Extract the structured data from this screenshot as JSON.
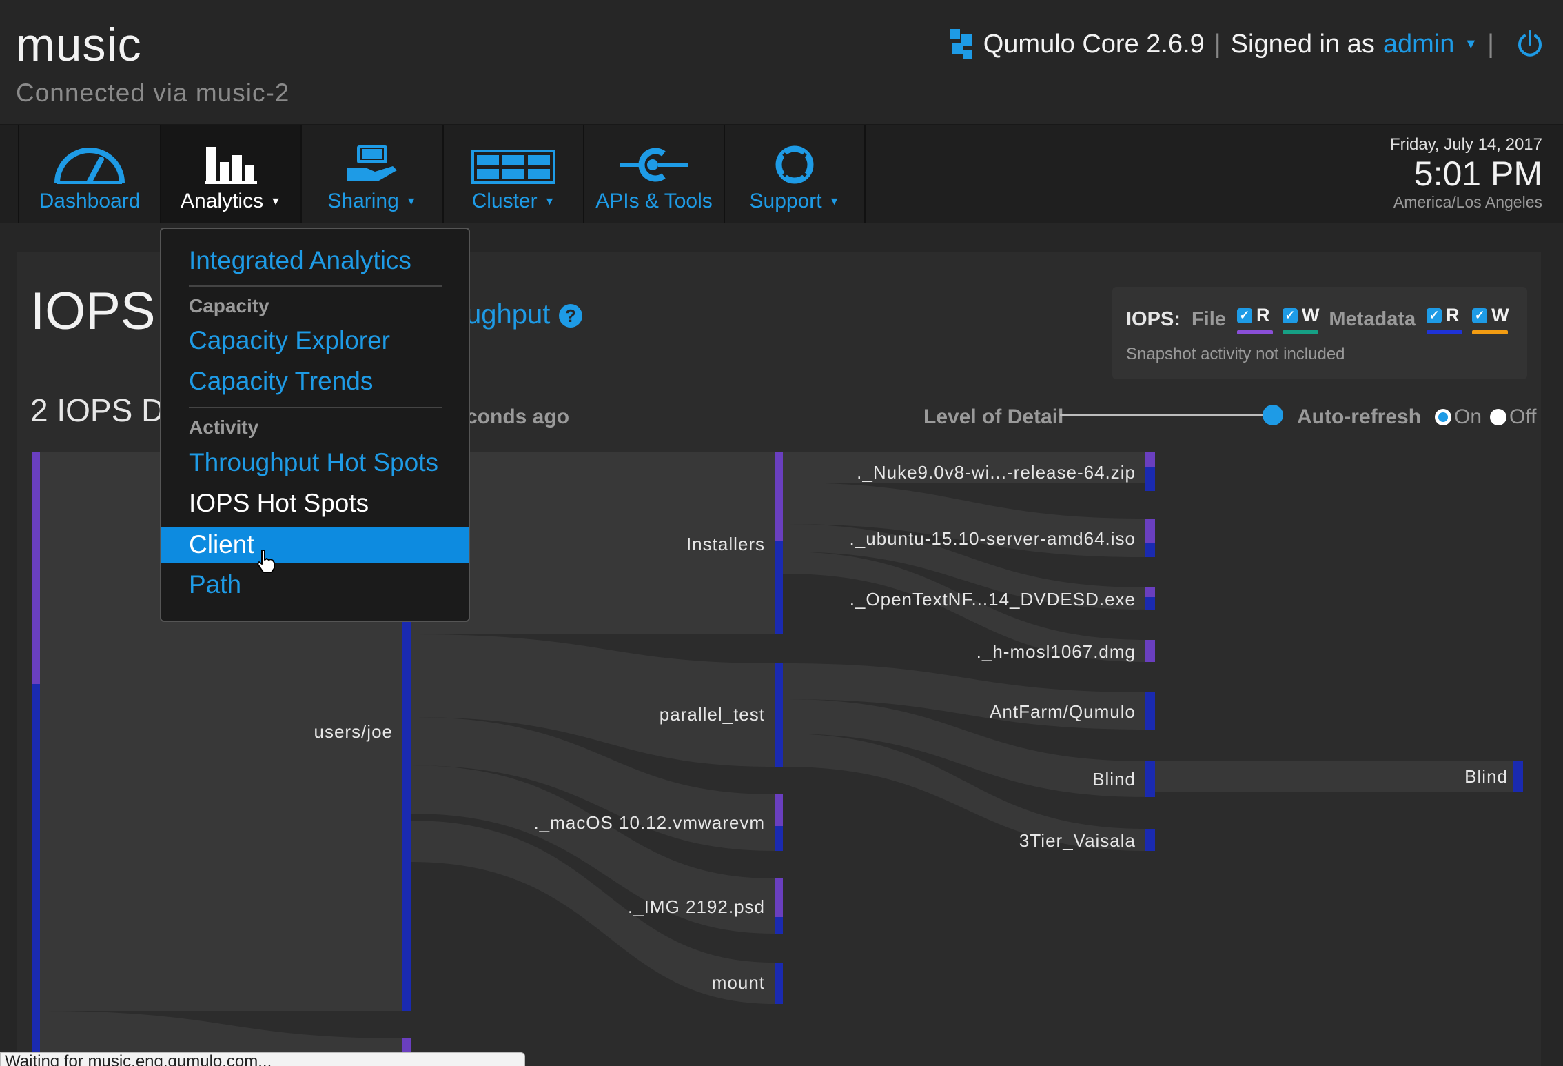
{
  "header": {
    "cluster_name": "music",
    "connected_via": "Connected via music-2",
    "product": "Qumulo Core 2.6.9",
    "signed_in_as": "Signed in as",
    "username": "admin"
  },
  "nav": {
    "items": [
      {
        "label": "Dashboard",
        "icon": "gauge-icon"
      },
      {
        "label": "Analytics",
        "icon": "bar-chart-icon",
        "active": true
      },
      {
        "label": "Sharing",
        "icon": "hand-share-icon"
      },
      {
        "label": "Cluster",
        "icon": "server-rack-icon"
      },
      {
        "label": "APIs & Tools",
        "icon": "api-plug-icon"
      },
      {
        "label": "Support",
        "icon": "lifebuoy-icon"
      }
    ]
  },
  "datetime": {
    "date": "Friday, July 14, 2017",
    "time": "5:01 PM",
    "timezone": "America/Los Angeles"
  },
  "page": {
    "title": "IOPS I",
    "title_link": "ughput",
    "summary": "2 IOPS D",
    "seconds_ago": "conds ago"
  },
  "legend": {
    "iops_label": "IOPS:",
    "file_label": "File",
    "metadata_label": "Metadata",
    "r": "R",
    "w": "W",
    "note": "Snapshot activity not included",
    "colors": {
      "file_r": "#8a4fd8",
      "file_w": "#16a085",
      "meta_r": "#1f33d8",
      "meta_w": "#f39c12"
    }
  },
  "controls": {
    "level_of_detail": "Level of Detail",
    "auto_refresh": "Auto-refresh",
    "on": "On",
    "off": "Off"
  },
  "dropdown": {
    "integrated": "Integrated Analytics",
    "capacity_header": "Capacity",
    "capacity_explorer": "Capacity Explorer",
    "capacity_trends": "Capacity Trends",
    "activity_header": "Activity",
    "throughput_hot_spots": "Throughput Hot Spots",
    "iops_hot_spots": "IOPS Hot Spots",
    "client": "Client",
    "path": "Path"
  },
  "sankey": {
    "nodes": {
      "users_joe": "users/joe",
      "installers": "Installers",
      "parallel_test": "parallel_test",
      "macos": "._macOS 10.12.vmwarevm",
      "img": "._IMG 2192.psd",
      "mount": "mount",
      "nuke": "._Nuke9.0v8-wi...-release-64.zip",
      "ubuntu": "._ubuntu-15.10-server-amd64.iso",
      "opentext": "._OpenTextNF...14_DVDESD.exe",
      "hmosl": "._h-mosl1067.dmg",
      "antfarm": "AntFarm/Qumulo",
      "blind": "Blind",
      "tier3": "3Tier_Vaisala",
      "blind2": "Blind"
    }
  },
  "status_bar": "Waiting for music.eng.qumulo.com..."
}
